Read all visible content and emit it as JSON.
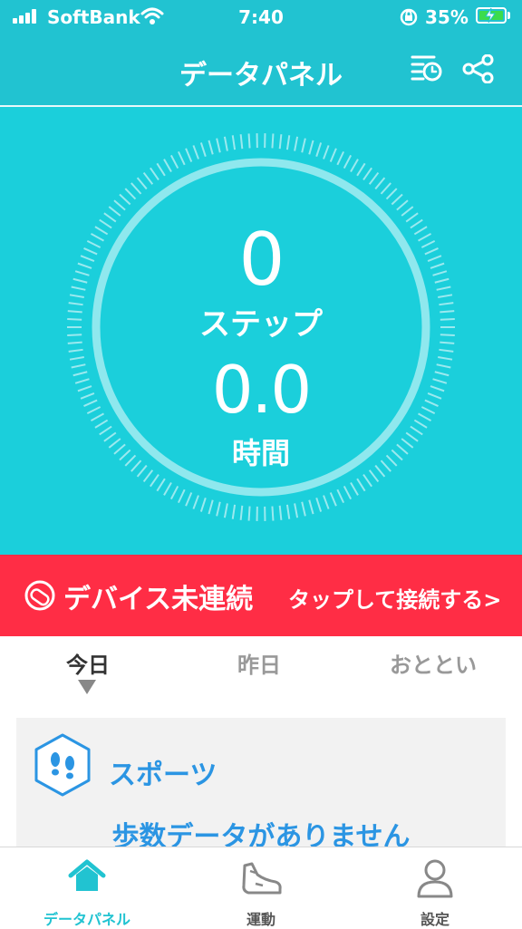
{
  "status_bar": {
    "carrier": "SoftBank",
    "time": "7:40",
    "battery": "35%"
  },
  "header": {
    "title": "データパネル"
  },
  "summary": {
    "steps_value": "0",
    "steps_label": "ステップ",
    "time_value": "0.0",
    "time_label": "時間"
  },
  "device": {
    "status": "デバイス未連続",
    "connect_link": "タップして接続する>"
  },
  "day_tabs": [
    {
      "label": "今日"
    },
    {
      "label": "昨日"
    },
    {
      "label": "おととい"
    }
  ],
  "sport_card": {
    "title": "スポーツ",
    "empty_message": "歩数データがありません"
  },
  "tab_bar": [
    {
      "label": "データパネル"
    },
    {
      "label": "運動"
    },
    {
      "label": "設定"
    }
  ],
  "colors": {
    "primary": "#21c3d1",
    "hero": "#1bcfdb",
    "alert": "#ff2d45",
    "accent_blue": "#2b95e3",
    "battery_green": "#3cdc4c"
  },
  "icons": [
    "signal-icon",
    "wifi-icon",
    "orientation-lock-icon",
    "battery-icon",
    "history-icon",
    "share-icon",
    "band-icon",
    "footprints-icon",
    "home-icon",
    "shoe-icon",
    "person-icon"
  ]
}
